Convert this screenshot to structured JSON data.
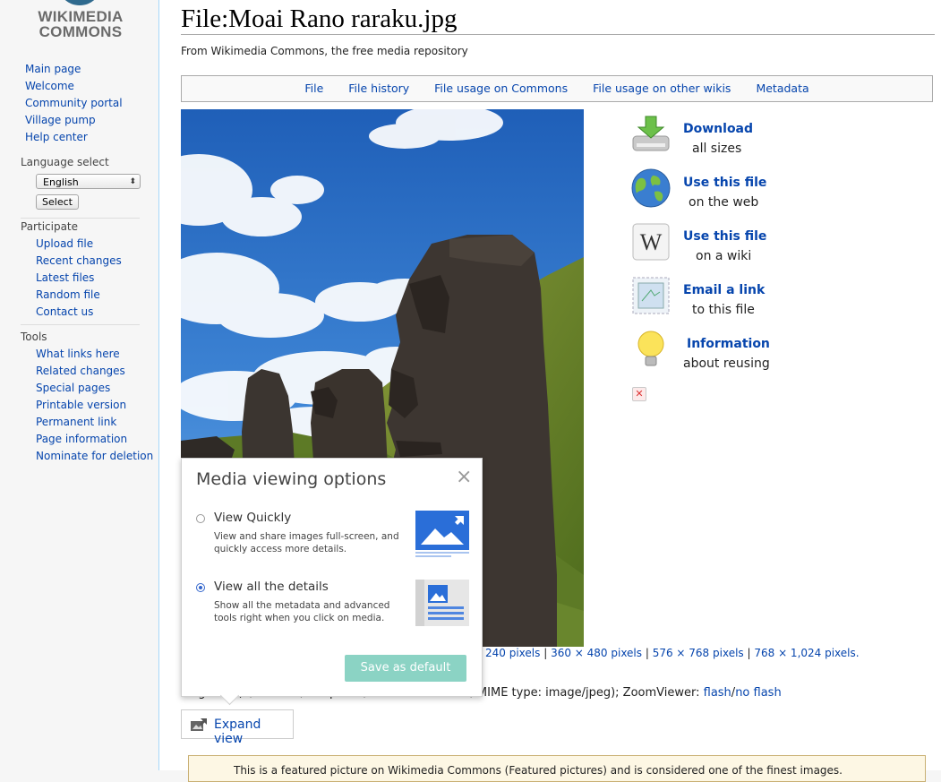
{
  "logo": {
    "line1": "WIKIMEDIA",
    "line2": "COMMONS"
  },
  "sidebar": {
    "main_nav": [
      "Main page",
      "Welcome",
      "Community portal",
      "Village pump",
      "Help center"
    ],
    "language": {
      "heading": "Language select",
      "selected": "English",
      "button": "Select"
    },
    "participate": {
      "heading": "Participate",
      "items": [
        "Upload file",
        "Recent changes",
        "Latest files",
        "Random file",
        "Contact us"
      ]
    },
    "tools": {
      "heading": "Tools",
      "items": [
        "What links here",
        "Related changes",
        "Special pages",
        "Printable version",
        "Permanent link",
        "Page information",
        "Nominate for deletion"
      ]
    }
  },
  "page": {
    "title": "File:Moai Rano raraku.jpg",
    "subtitle": "From Wikimedia Commons, the free media repository",
    "toc": [
      "File",
      "File history",
      "File usage on Commons",
      "File usage on other wikis",
      "Metadata"
    ]
  },
  "sidebox": [
    {
      "icon": "download-icon",
      "title": "Download",
      "sub": "all sizes"
    },
    {
      "icon": "globe-icon",
      "title": "Use this file",
      "sub": "on the web"
    },
    {
      "icon": "wikipedia-icon",
      "title": "Use this file",
      "sub": "on a wiki"
    },
    {
      "icon": "email-icon",
      "title": "Email a link",
      "sub": "to this file"
    },
    {
      "icon": "lightbulb-icon",
      "title": "Information",
      "sub": "about reusing"
    }
  ],
  "resolutions": {
    "first": "240 pixels",
    "others": [
      "360 × 480 pixels",
      "576 × 768 pixels",
      "768 × 1,024 pixels."
    ]
  },
  "fileinfo": {
    "prefix": "Original fi",
    "obscured": "(1,704 × 2,500 pixels, file size: 1.69 MB,",
    "mime": " MIME type: image/jpeg); ZoomViewer: ",
    "flash": "flash",
    "noflash": "no flash"
  },
  "expand_view": "Expand view",
  "featured_text": "This is a featured picture on Wikimedia Commons (Featured pictures) and is considered one of the finest images.",
  "popup": {
    "title": "Media viewing options",
    "close": "×",
    "options": [
      {
        "label": "View Quickly",
        "desc": "View and share images full-screen, and quickly access more details.",
        "selected": false
      },
      {
        "label": "View all the details",
        "desc": "Show all the metadata and advanced tools right when you click on media.",
        "selected": true
      }
    ],
    "save": "Save as default"
  }
}
